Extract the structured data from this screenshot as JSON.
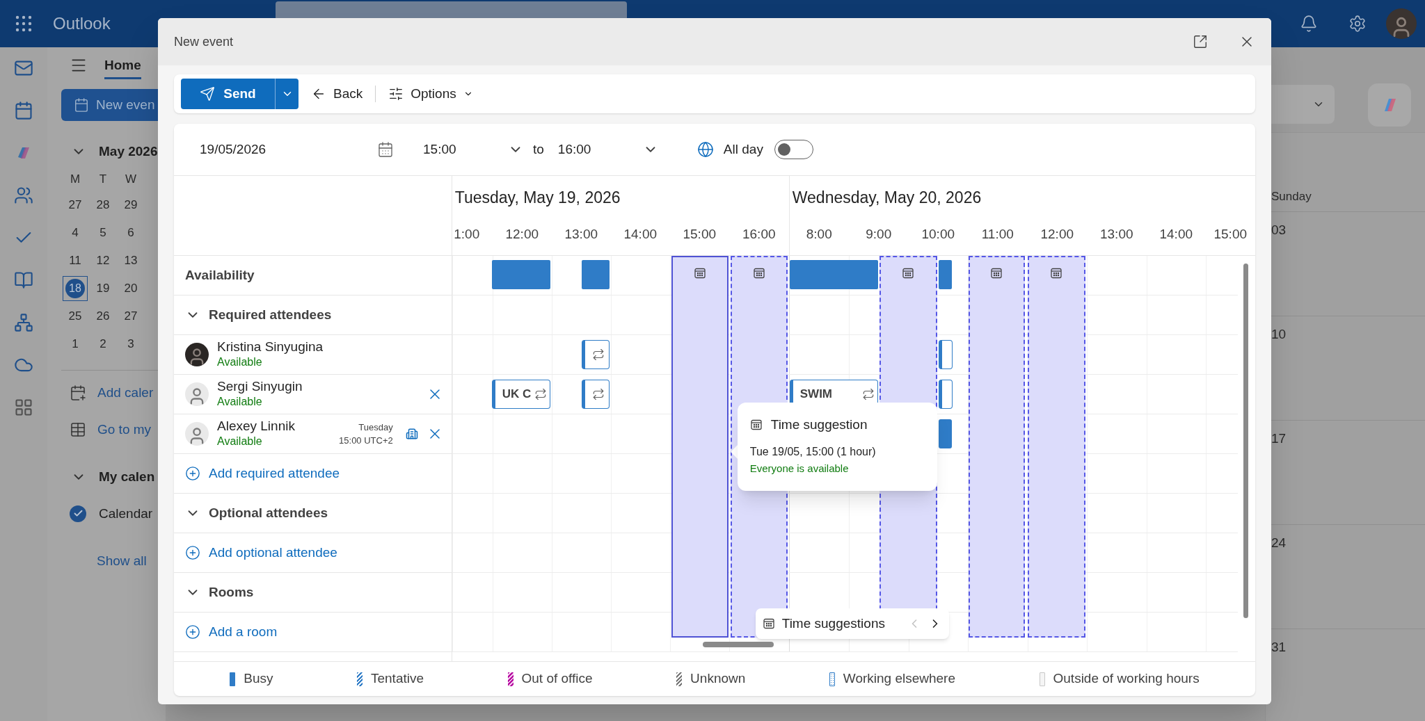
{
  "app": {
    "name": "Outlook"
  },
  "left_pane": {
    "tab": "Home",
    "new_event": "New even",
    "month": "May 2026",
    "weekdays": [
      "M",
      "T",
      "W"
    ],
    "weeks": [
      [
        {
          "day": "27",
          "selected": false
        },
        {
          "day": "28",
          "selected": false
        },
        {
          "day": "29",
          "selected": false
        }
      ],
      [
        {
          "day": "4",
          "selected": false
        },
        {
          "day": "5",
          "selected": false
        },
        {
          "day": "6",
          "selected": false
        }
      ],
      [
        {
          "day": "11",
          "selected": false
        },
        {
          "day": "12",
          "selected": false
        },
        {
          "day": "13",
          "selected": false
        }
      ],
      [
        {
          "day": "18",
          "selected": true
        },
        {
          "day": "19",
          "selected": false
        },
        {
          "day": "20",
          "selected": false
        }
      ],
      [
        {
          "day": "25",
          "selected": false
        },
        {
          "day": "26",
          "selected": false
        },
        {
          "day": "27",
          "selected": false
        }
      ],
      [
        {
          "day": "1",
          "selected": false
        },
        {
          "day": "2",
          "selected": false
        },
        {
          "day": "3",
          "selected": false
        }
      ]
    ],
    "links": [
      "Add caler",
      "Go to my"
    ],
    "my_calendars": {
      "title": "My calen",
      "items": [
        {
          "label": "Calendar",
          "checked": true
        }
      ],
      "show_all": "Show all"
    }
  },
  "month_view": {
    "weekday": "Sunday",
    "dates": [
      "03",
      "10",
      "17",
      "24",
      "31"
    ]
  },
  "dialog": {
    "title": "New event",
    "toolbar": {
      "send": "Send",
      "back": "Back",
      "options": "Options"
    },
    "date": "19/05/2026",
    "start": "15:00",
    "to": "to",
    "end": "16:00",
    "all_day": {
      "label": "All day",
      "on": false
    },
    "days": [
      {
        "label": "Tuesday, May 19, 2026",
        "hours": [
          "1:00",
          "12:00",
          "13:00",
          "14:00",
          "15:00",
          "16:00"
        ]
      },
      {
        "label": "Wednesday, May 20, 2026",
        "hours": [
          "8:00",
          "9:00",
          "10:00",
          "11:00",
          "12:00",
          "13:00",
          "14:00",
          "15:00"
        ]
      }
    ],
    "availability": "Availability",
    "required": {
      "title": "Required attendees",
      "expanded": true,
      "attendees": [
        {
          "name": "Kristina Sinyugina",
          "status": "Available",
          "removable": false,
          "events": [
            {
              "kind": "card",
              "recurring": true
            },
            {
              "kind": "card",
              "recurring": false
            }
          ]
        },
        {
          "name": "Sergi Sinyugin",
          "status": "Available",
          "removable": true,
          "events": [
            {
              "kind": "card",
              "label": "UK C",
              "recurring": true
            },
            {
              "kind": "card",
              "recurring": true
            },
            {
              "kind": "card",
              "label": "SWIM",
              "recurring": true
            },
            {
              "kind": "card",
              "recurring": false
            }
          ]
        },
        {
          "name": "Alexey Linnik",
          "status": "Available",
          "local_day": "Tuesday",
          "local_time": "15:00 UTC+2",
          "removable": true,
          "events": [
            {
              "kind": "solid"
            }
          ]
        }
      ],
      "add": "Add required attendee"
    },
    "optional": {
      "title": "Optional attendees",
      "expanded": true,
      "add": "Add optional attendee"
    },
    "rooms": {
      "title": "Rooms",
      "expanded": true,
      "add": "Add a room"
    },
    "suggestions": [
      {
        "selected": true
      },
      {
        "selected": false
      },
      {
        "selected": false
      },
      {
        "selected": false
      },
      {
        "selected": false
      }
    ],
    "tooltip": {
      "title": "Time suggestion",
      "when": "Tue 19/05, 15:00 (1 hour)",
      "note": "Everyone is available"
    },
    "suggestion_bar": {
      "label": "Time suggestions",
      "prev_disabled": true,
      "next_disabled": false
    },
    "legend": [
      {
        "kind": "busy",
        "label": "Busy"
      },
      {
        "kind": "tentative",
        "label": "Tentative"
      },
      {
        "kind": "oof",
        "label": "Out of office"
      },
      {
        "kind": "unknown",
        "label": "Unknown"
      },
      {
        "kind": "elsewhere",
        "label": "Working elsewhere"
      },
      {
        "kind": "outside",
        "label": "Outside of working hours"
      }
    ]
  }
}
